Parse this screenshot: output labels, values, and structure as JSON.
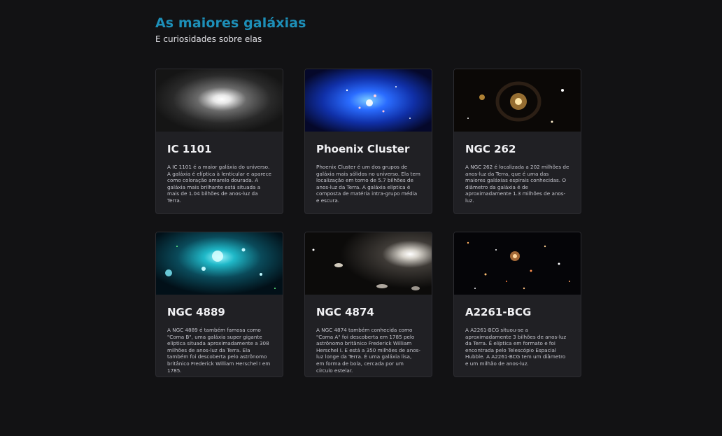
{
  "page": {
    "title": "As maiores galáxias",
    "subtitle": "E curiosidades sobre elas"
  },
  "galaxies": [
    {
      "name": "IC 1101",
      "description": "A IC 1101 é a maior galáxia do universo. A galáxia é elíptica à lenticular e aparece como coloração amarelo dourada. A galáxia mais brilhante está situada a mais de 1.04 bilhões de anos-luz da Terra."
    },
    {
      "name": "Phoenix Cluster",
      "description": "Phoenix Cluster é um dos grupos de galáxia mais sólidos no universo. Ela tem localização em torno de 5.7 bilhões de anos-luz da Terra. A galáxia elíptica é composta de matéria intra-grupo média e escura."
    },
    {
      "name": "NGC 262",
      "description": "A NGC 262 é localizada a 202 milhões de anos-luz da Terra, que é uma das maiores galáxias espirais conhecidas. O diâmetro da galáxia é de aproximadamente 1.3 milhões de anos-luz."
    },
    {
      "name": "NGC 4889",
      "description": "A NGC 4889 é também famosa como \"Coma B\", uma galáxia super gigante elíptica situada aproximadamente a 308 milhões de anos-luz da Terra. Ela também foi descoberta pelo astrônomo britânico Frederick William Herschel I em 1785."
    },
    {
      "name": "NGC 4874",
      "description": "A NGC 4874 também conhecida como \"Coma A\" foi descoberta em 1785 pelo astrônomo britânico Frederick William Herschel I. E está a 350 milhões de anos-luz longe da Terra. É uma galáxia lisa, em forma de bola, cercada por um círculo estelar."
    },
    {
      "name": "A2261-BCG",
      "description": "A A2261-BCG situou-se a aproximadamente 3 bilhões de anos-luz da Terra. É elíptica em formato e foi encontrada pelo Telescópio Espacial Hubble. A A2261-BCG tem um diâmetro e um milhão de anos-luz."
    }
  ],
  "colors": {
    "background": "#121214",
    "card": "#202024",
    "title": "#1d8fb8"
  }
}
